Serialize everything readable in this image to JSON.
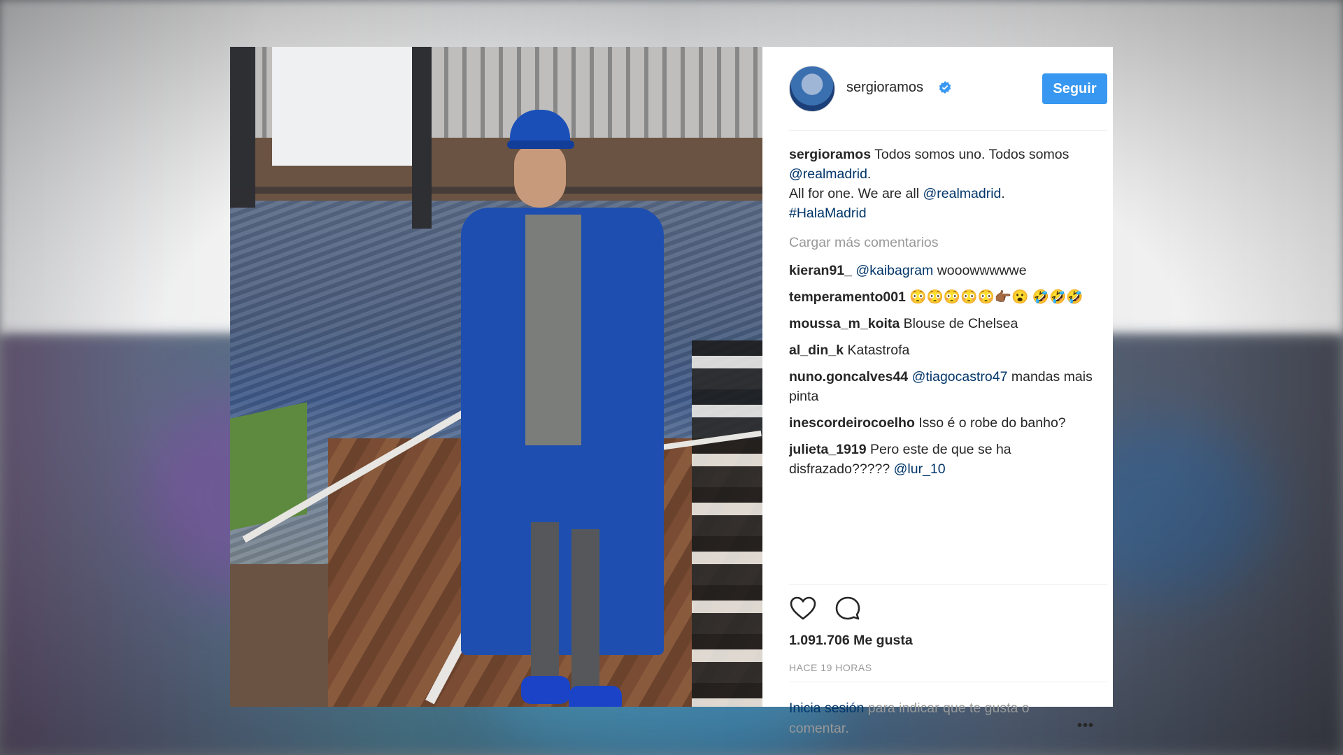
{
  "header": {
    "username": "sergioramos",
    "follow_label": "Seguir"
  },
  "caption": {
    "username": "sergioramos",
    "text_1": "Todos somos uno. Todos somos",
    "mention_1": "@realmadrid",
    "text_2": ".",
    "text_3": "All for one. We are all",
    "mention_2": "@realmadrid",
    "text_4": ".",
    "hashtag": "#HalaMadrid"
  },
  "load_more": "Cargar más comentarios",
  "comments": [
    {
      "user": "kieran91_",
      "mention": "@kaibagram",
      "text": "wooowwwwwe"
    },
    {
      "user": "temperamento001",
      "text": "😳😳😳😳😳👉🏾😮 🤣🤣🤣"
    },
    {
      "user": "moussa_m_koita",
      "text": "Blouse de Chelsea"
    },
    {
      "user": "al_din_k",
      "text": "Katastrofa"
    },
    {
      "user": "nuno.goncalves44",
      "mention": "@tiagocastro47",
      "text": "mandas mais pinta"
    },
    {
      "user": "inescordeirocoelho",
      "text": "Isso é o robe do banho?"
    },
    {
      "user": "julieta_1919",
      "text": "Pero este de que se ha disfrazado?????",
      "mention_after": "@lur_10"
    }
  ],
  "likes": "1.091.706 Me gusta",
  "time": "HACE 19 HORAS",
  "login": {
    "link": "Inicia sesión",
    "text": "para indicar que te gusta o comentar."
  },
  "more_label": "•••",
  "icons": [
    "verified-badge-icon",
    "heart-icon",
    "comment-icon",
    "more-options-icon"
  ],
  "colors": {
    "follow_button": "#3897f0",
    "link": "#003569",
    "muted": "#999999",
    "text": "#262626"
  }
}
